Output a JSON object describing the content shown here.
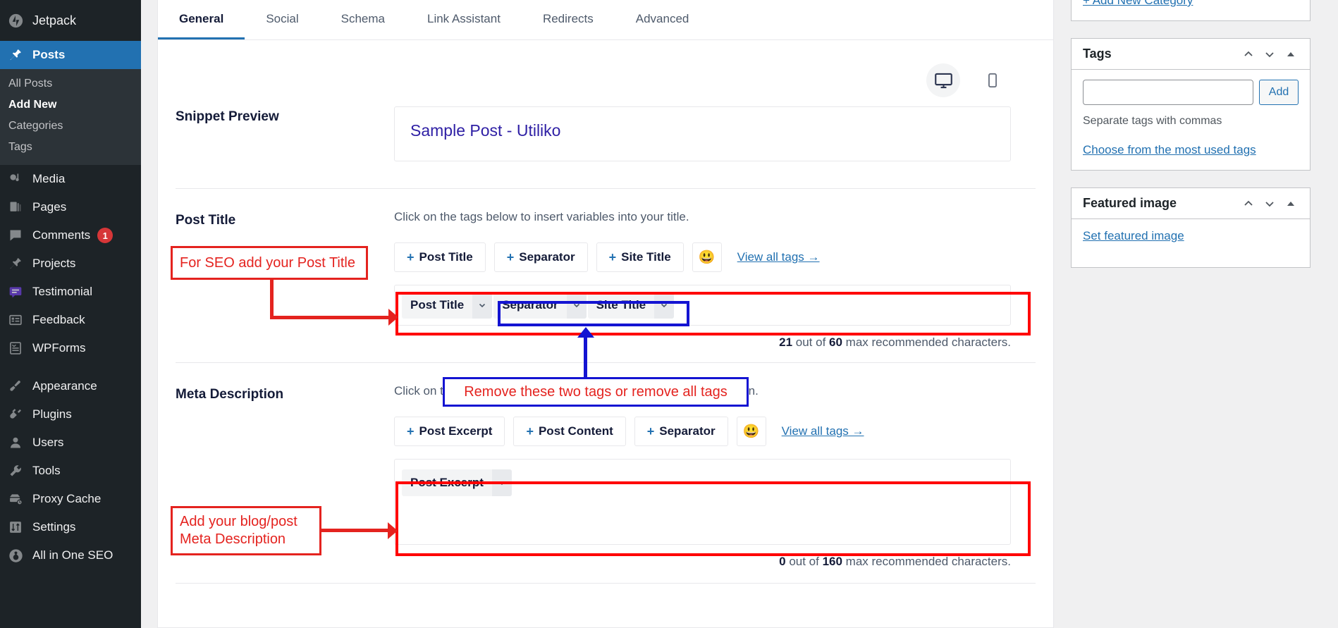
{
  "sidebar": {
    "items": [
      {
        "label": "Jetpack",
        "icon": "jetpack-icon",
        "state": "top"
      },
      {
        "label": "Posts",
        "icon": "pin-icon",
        "state": "current"
      },
      {
        "label": "Media",
        "icon": "media-icon",
        "state": "normal"
      },
      {
        "label": "Pages",
        "icon": "pages-icon",
        "state": "normal"
      },
      {
        "label": "Comments",
        "icon": "comment-icon",
        "state": "normal",
        "badge": "1"
      },
      {
        "label": "Projects",
        "icon": "pin-icon",
        "state": "normal"
      },
      {
        "label": "Testimonial",
        "icon": "testimonial-icon",
        "state": "normal"
      },
      {
        "label": "Feedback",
        "icon": "feedback-icon",
        "state": "normal"
      },
      {
        "label": "WPForms",
        "icon": "wpforms-icon",
        "state": "normal"
      },
      {
        "label": "Appearance",
        "icon": "brush-icon",
        "state": "normal"
      },
      {
        "label": "Plugins",
        "icon": "plugin-icon",
        "state": "normal"
      },
      {
        "label": "Users",
        "icon": "user-icon",
        "state": "normal"
      },
      {
        "label": "Tools",
        "icon": "wrench-icon",
        "state": "normal"
      },
      {
        "label": "Proxy Cache",
        "icon": "cache-icon",
        "state": "normal"
      },
      {
        "label": "Settings",
        "icon": "settings-icon",
        "state": "normal"
      },
      {
        "label": "All in One SEO",
        "icon": "aioseo-icon",
        "state": "normal"
      }
    ],
    "submenu": [
      {
        "label": "All Posts",
        "current": false
      },
      {
        "label": "Add New",
        "current": true
      },
      {
        "label": "Categories",
        "current": false
      },
      {
        "label": "Tags",
        "current": false
      }
    ]
  },
  "tabs": [
    {
      "label": "General",
      "active": true
    },
    {
      "label": "Social",
      "active": false
    },
    {
      "label": "Schema",
      "active": false
    },
    {
      "label": "Link Assistant",
      "active": false
    },
    {
      "label": "Redirects",
      "active": false
    },
    {
      "label": "Advanced",
      "active": false
    }
  ],
  "device_toggle": {
    "desktop_icon": "desktop-icon",
    "mobile_icon": "mobile-icon",
    "selected": "desktop"
  },
  "snippet": {
    "label": "Snippet Preview",
    "title": "Sample Post - Utiliko"
  },
  "post_title": {
    "label": "Post Title",
    "helper": "Click on the tags below to insert variables into your title.",
    "tag_buttons": [
      "Post Title",
      "Separator",
      "Site Title"
    ],
    "emoji": "😃",
    "view_all": "View all tags →",
    "chips": [
      "Post Title",
      "Separator",
      "Site Title"
    ],
    "counter_used": "21",
    "counter_max": "60",
    "counter_prefix": " out of ",
    "counter_suffix": " max recommended characters."
  },
  "meta_description": {
    "label": "Meta Description",
    "helper": "Click on the tags below to insert variables into your meta description.",
    "tag_buttons": [
      "Post Excerpt",
      "Post Content",
      "Separator"
    ],
    "emoji": "😃",
    "view_all": "View all tags →",
    "chips": [
      "Post Excerpt"
    ],
    "counter_used": "0",
    "counter_max": "160",
    "counter_prefix": " out of ",
    "counter_suffix": " max recommended characters."
  },
  "right_sidebar": {
    "categories": {
      "add_new_link": "+ Add New Category"
    },
    "tags": {
      "title": "Tags",
      "input_value": "",
      "add_label": "Add",
      "hint": "Separate tags with commas",
      "most_used_link": "Choose from the most used tags"
    },
    "featured_image": {
      "title": "Featured image",
      "set_link": "Set featured image"
    },
    "order_icons": [
      "chevron-up-icon",
      "chevron-down-icon",
      "collapse-triangle-icon"
    ]
  },
  "annotations": [
    {
      "id": "anno-seo-title",
      "text": "For SEO add your Post Title",
      "color": "#e4231f"
    },
    {
      "id": "anno-remove-tags",
      "text": "Remove these two tags or remove all tags",
      "color": "#e4231f",
      "border": "#1414d2"
    },
    {
      "id": "anno-meta-desc",
      "text": "Add your blog/post\nMeta Description",
      "color": "#e4231f"
    }
  ],
  "colors": {
    "accent": "#2271b1",
    "sidebar_bg": "#1d2327",
    "annotation_red": "#e4231f",
    "annotation_blue": "#1414d2",
    "snippet_title": "#2f20a5",
    "badge_red": "#d63638"
  }
}
